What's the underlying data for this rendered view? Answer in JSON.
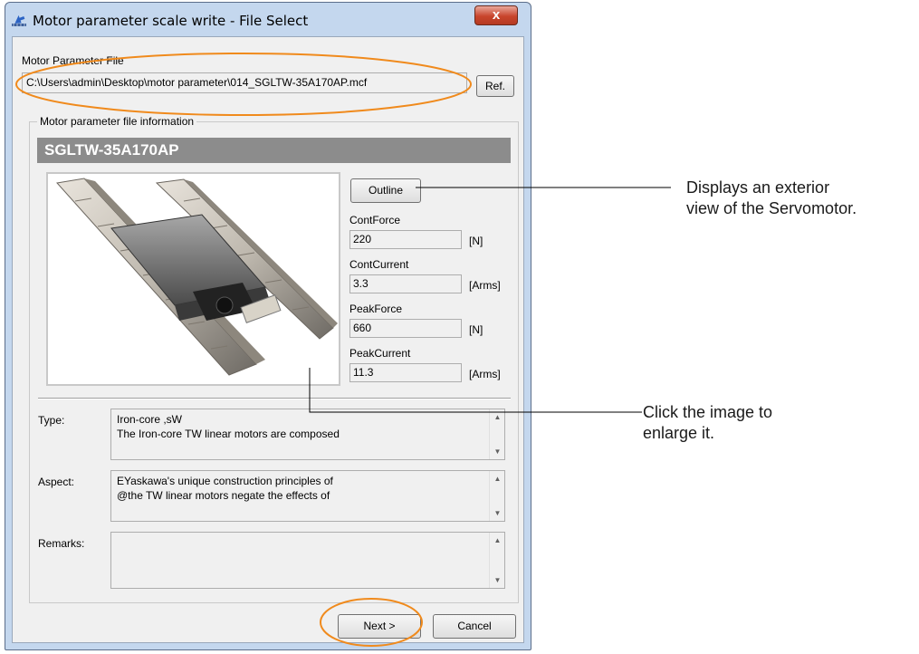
{
  "window": {
    "title": "Motor parameter scale write - File Select",
    "close_label": "x"
  },
  "file": {
    "label": "Motor Parameter File",
    "path": "C:\\Users\\admin\\Desktop\\motor parameter\\014_SGLTW-35A170AP.mcf",
    "ref_label": "Ref."
  },
  "info": {
    "group_label": "Motor parameter file information",
    "model": "SGLTW-35A170AP",
    "outline_label": "Outline",
    "specs": [
      {
        "label": "ContForce",
        "value": "220",
        "unit": "[N]"
      },
      {
        "label": "ContCurrent",
        "value": "3.3",
        "unit": "[Arms]"
      },
      {
        "label": "PeakForce",
        "value": "660",
        "unit": "[N]"
      },
      {
        "label": "PeakCurrent",
        "value": "11.3",
        "unit": "[Arms]"
      }
    ],
    "type_label": "Type:",
    "type_text": [
      "Iron-core ,sW",
      "The Iron-core TW linear motors are composed"
    ],
    "aspect_label": "Aspect:",
    "aspect_text": [
      "EYaskawa's unique construction principles of",
      "@the TW linear motors negate the effects of"
    ],
    "remarks_label": "Remarks:",
    "remarks_text": ""
  },
  "buttons": {
    "next": "Next >",
    "cancel": "Cancel"
  },
  "annotations": {
    "outline_line1": "Displays an exterior",
    "outline_line2": "view of the Servomotor.",
    "image_line1": "Click the image to",
    "image_line2": "enlarge it."
  },
  "colors": {
    "highlight_ellipse": "#f08a1c",
    "close_button": "#c8452c",
    "model_header": "#8c8c8c"
  },
  "icons": [
    "app-icon",
    "close-icon",
    "scroll-up-icon",
    "scroll-down-icon"
  ]
}
